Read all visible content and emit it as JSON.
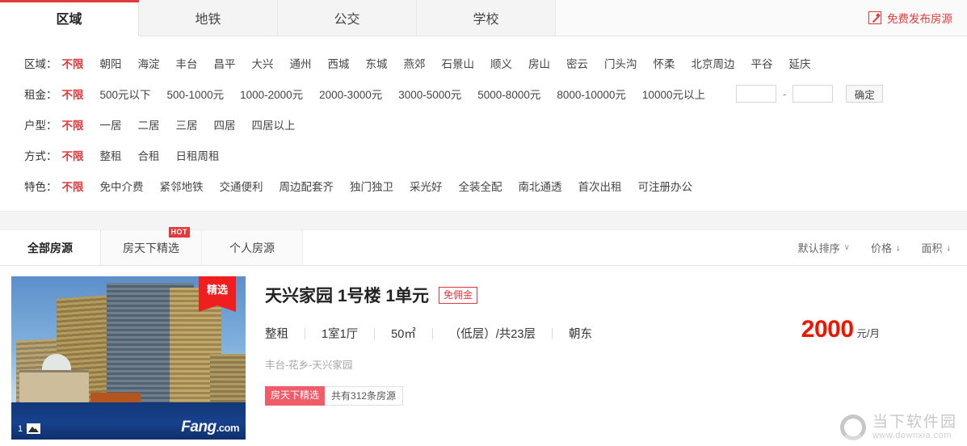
{
  "header": {
    "tabs": [
      {
        "label": "区域",
        "active": true
      },
      {
        "label": "地铁",
        "active": false
      },
      {
        "label": "公交",
        "active": false
      },
      {
        "label": "学校",
        "active": false
      }
    ],
    "publish_link": "免费发布房源",
    "publish_icon": "pencil-icon",
    "accent_color": "#e3393c"
  },
  "filters": {
    "region": {
      "label": "区域：",
      "options": [
        "不限",
        "朝阳",
        "海淀",
        "丰台",
        "昌平",
        "大兴",
        "通州",
        "西城",
        "东城",
        "燕郊",
        "石景山",
        "顺义",
        "房山",
        "密云",
        "门头沟",
        "怀柔",
        "北京周边",
        "平谷",
        "延庆"
      ],
      "selected": "不限"
    },
    "rent": {
      "label": "租金：",
      "options": [
        "不限",
        "500元以下",
        "500-1000元",
        "1000-2000元",
        "2000-3000元",
        "3000-5000元",
        "5000-8000元",
        "8000-10000元",
        "10000元以上"
      ],
      "selected": "不限",
      "min_value": "",
      "max_value": "",
      "range_separator": "-",
      "confirm_label": "确定"
    },
    "layout": {
      "label": "户型：",
      "options": [
        "不限",
        "一居",
        "二居",
        "三居",
        "四居",
        "四居以上"
      ],
      "selected": "不限"
    },
    "mode": {
      "label": "方式：",
      "options": [
        "不限",
        "整租",
        "合租",
        "日租周租"
      ],
      "selected": "不限"
    },
    "feature": {
      "label": "特色：",
      "options": [
        "不限",
        "免中介费",
        "紧邻地铁",
        "交通便利",
        "周边配套齐",
        "独门独卫",
        "采光好",
        "全装全配",
        "南北通透",
        "首次出租",
        "可注册办公"
      ],
      "selected": "不限"
    }
  },
  "list_header": {
    "tabs": [
      {
        "label": "全部房源",
        "active": true,
        "badge": ""
      },
      {
        "label": "房天下精选",
        "active": false,
        "badge": "HOT"
      },
      {
        "label": "个人房源",
        "active": false,
        "badge": ""
      }
    ],
    "sort": [
      {
        "label": "默认排序",
        "icon": "chevron-down-icon",
        "glyph": "∨"
      },
      {
        "label": "价格",
        "icon": "arrow-down-icon",
        "glyph": "↓"
      },
      {
        "label": "面积",
        "icon": "arrow-down-icon",
        "glyph": "↓"
      }
    ]
  },
  "listing": {
    "thumbnail": {
      "ribbon_badge": "精选",
      "photo_count": "1",
      "photo_icon": "photo-icon",
      "watermark_main": "Fang",
      "watermark_suffix": ".com"
    },
    "title": "天兴家园 1号楼 1单元",
    "title_badge": "免佣金",
    "meta": [
      "整租",
      "1室1厅",
      "50㎡",
      "（低层）/共23层",
      "朝东"
    ],
    "address": "丰台-花乡-天兴家园",
    "tag_featured": "房天下精选",
    "tag_count": "共有312条房源",
    "price": "2000",
    "price_unit": "元/月",
    "price_color": "#f01400"
  },
  "watermark": {
    "logo": "circle-o-logo",
    "name": "当下软件园",
    "url": "www.downxia.com"
  }
}
